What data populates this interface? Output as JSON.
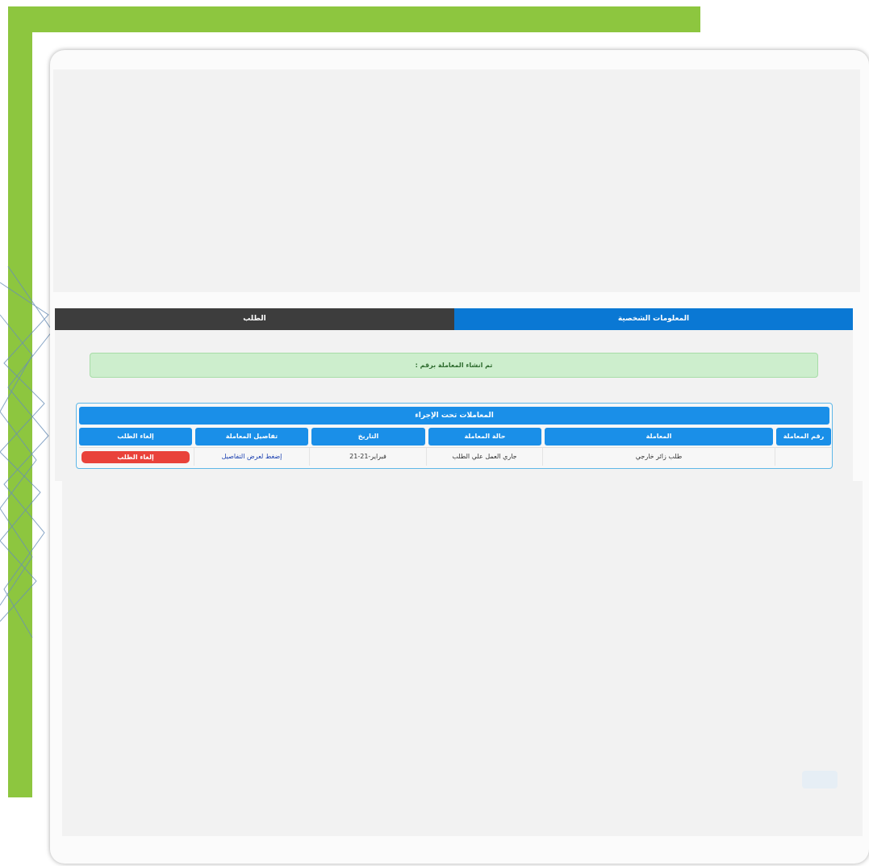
{
  "colors": {
    "brand_green": "#8dc63f",
    "tab_active": "#0a78d4",
    "tab_inactive": "#3d3d3d",
    "table_header": "#1a8fe8",
    "success_bg": "#cdeecd",
    "danger": "#e9423a"
  },
  "tabs": [
    {
      "label": "الطلب",
      "active": false
    },
    {
      "label": "المعلومات الشخصية",
      "active": true
    }
  ],
  "alert": {
    "text": "تم انشاء المعاملة برقم :"
  },
  "transactions": {
    "title": "المعاملات تحت الإجراء",
    "headers": {
      "number": "رقم المعاملة",
      "transaction": "المعاملة",
      "status": "حالة المعاملة",
      "date": "التاريخ",
      "details": "تفاصيل المعاملة",
      "cancel": "إلغاء الطلب"
    },
    "rows": [
      {
        "number": "",
        "transaction": "طلب زائر خارجي",
        "status": "جاري العمل علي الطلب",
        "date": "21-فبراير-21",
        "details_link": "إضغط لعرض التفاصيل",
        "cancel_button": "إلغاء الطلب"
      }
    ]
  }
}
